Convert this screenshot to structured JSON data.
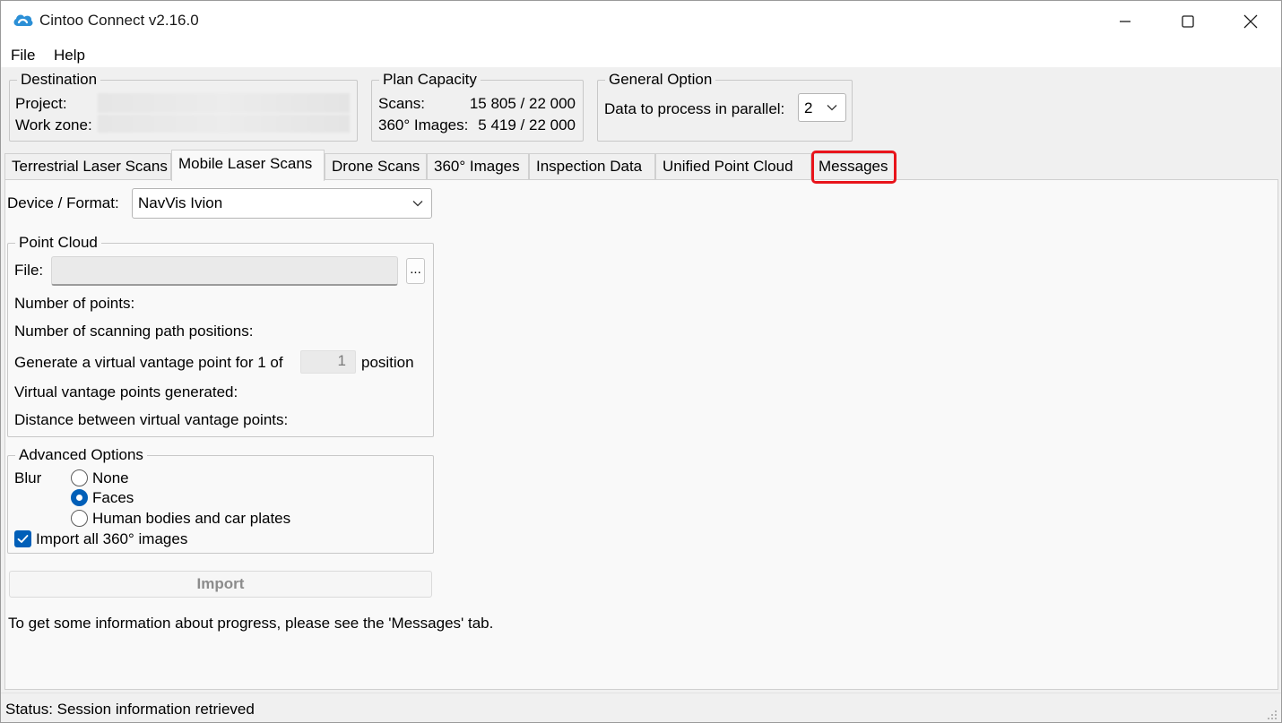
{
  "window": {
    "title": "Cintoo Connect v2.16.0"
  },
  "menu": {
    "file": "File",
    "help": "Help"
  },
  "destination": {
    "title": "Destination",
    "project_label": "Project:",
    "workzone_label": "Work zone:"
  },
  "plan_capacity": {
    "title": "Plan Capacity",
    "scans_label": "Scans:",
    "scans_value": "15 805 / 22 000",
    "images_label": "360° Images:",
    "images_value": "5 419 / 22 000"
  },
  "general_option": {
    "title": "General Option",
    "parallel_label": "Data to process in parallel:",
    "parallel_value": "2"
  },
  "tabs": [
    {
      "label": "Terrestrial Laser Scans"
    },
    {
      "label": "Mobile Laser Scans",
      "active": true
    },
    {
      "label": "Drone Scans"
    },
    {
      "label": "360° Images"
    },
    {
      "label": "Inspection Data"
    },
    {
      "label": "Unified Point Cloud"
    },
    {
      "label": "Messages",
      "highlighted": true,
      "highlight_color": "#e8141b"
    }
  ],
  "device": {
    "label": "Device / Format:",
    "value": "NavVis Ivion"
  },
  "point_cloud": {
    "title": "Point Cloud",
    "file_label": "File:",
    "browse_label": "...",
    "num_points_label": "Number of points:",
    "num_positions_label": "Number of scanning path positions:",
    "vantage_prefix": "Generate a virtual vantage point for 1 of",
    "vantage_value": "1",
    "vantage_suffix": "position",
    "generated_label": "Virtual vantage points generated:",
    "distance_label": "Distance between virtual vantage points:"
  },
  "advanced": {
    "title": "Advanced Options",
    "blur_label": "Blur",
    "options": [
      {
        "label": "None",
        "selected": false
      },
      {
        "label": "Faces",
        "selected": true
      },
      {
        "label": "Human bodies and car plates",
        "selected": false
      }
    ],
    "import_360_label": "Import all 360° images",
    "import_360_checked": true
  },
  "import_button": "Import",
  "info_text": "To get some information about progress, please see the 'Messages' tab.",
  "status": "Status: Session information retrieved",
  "colors": {
    "accent": "#005fb8",
    "highlight": "#e8141b",
    "app_icon": "#2b8fd6"
  }
}
